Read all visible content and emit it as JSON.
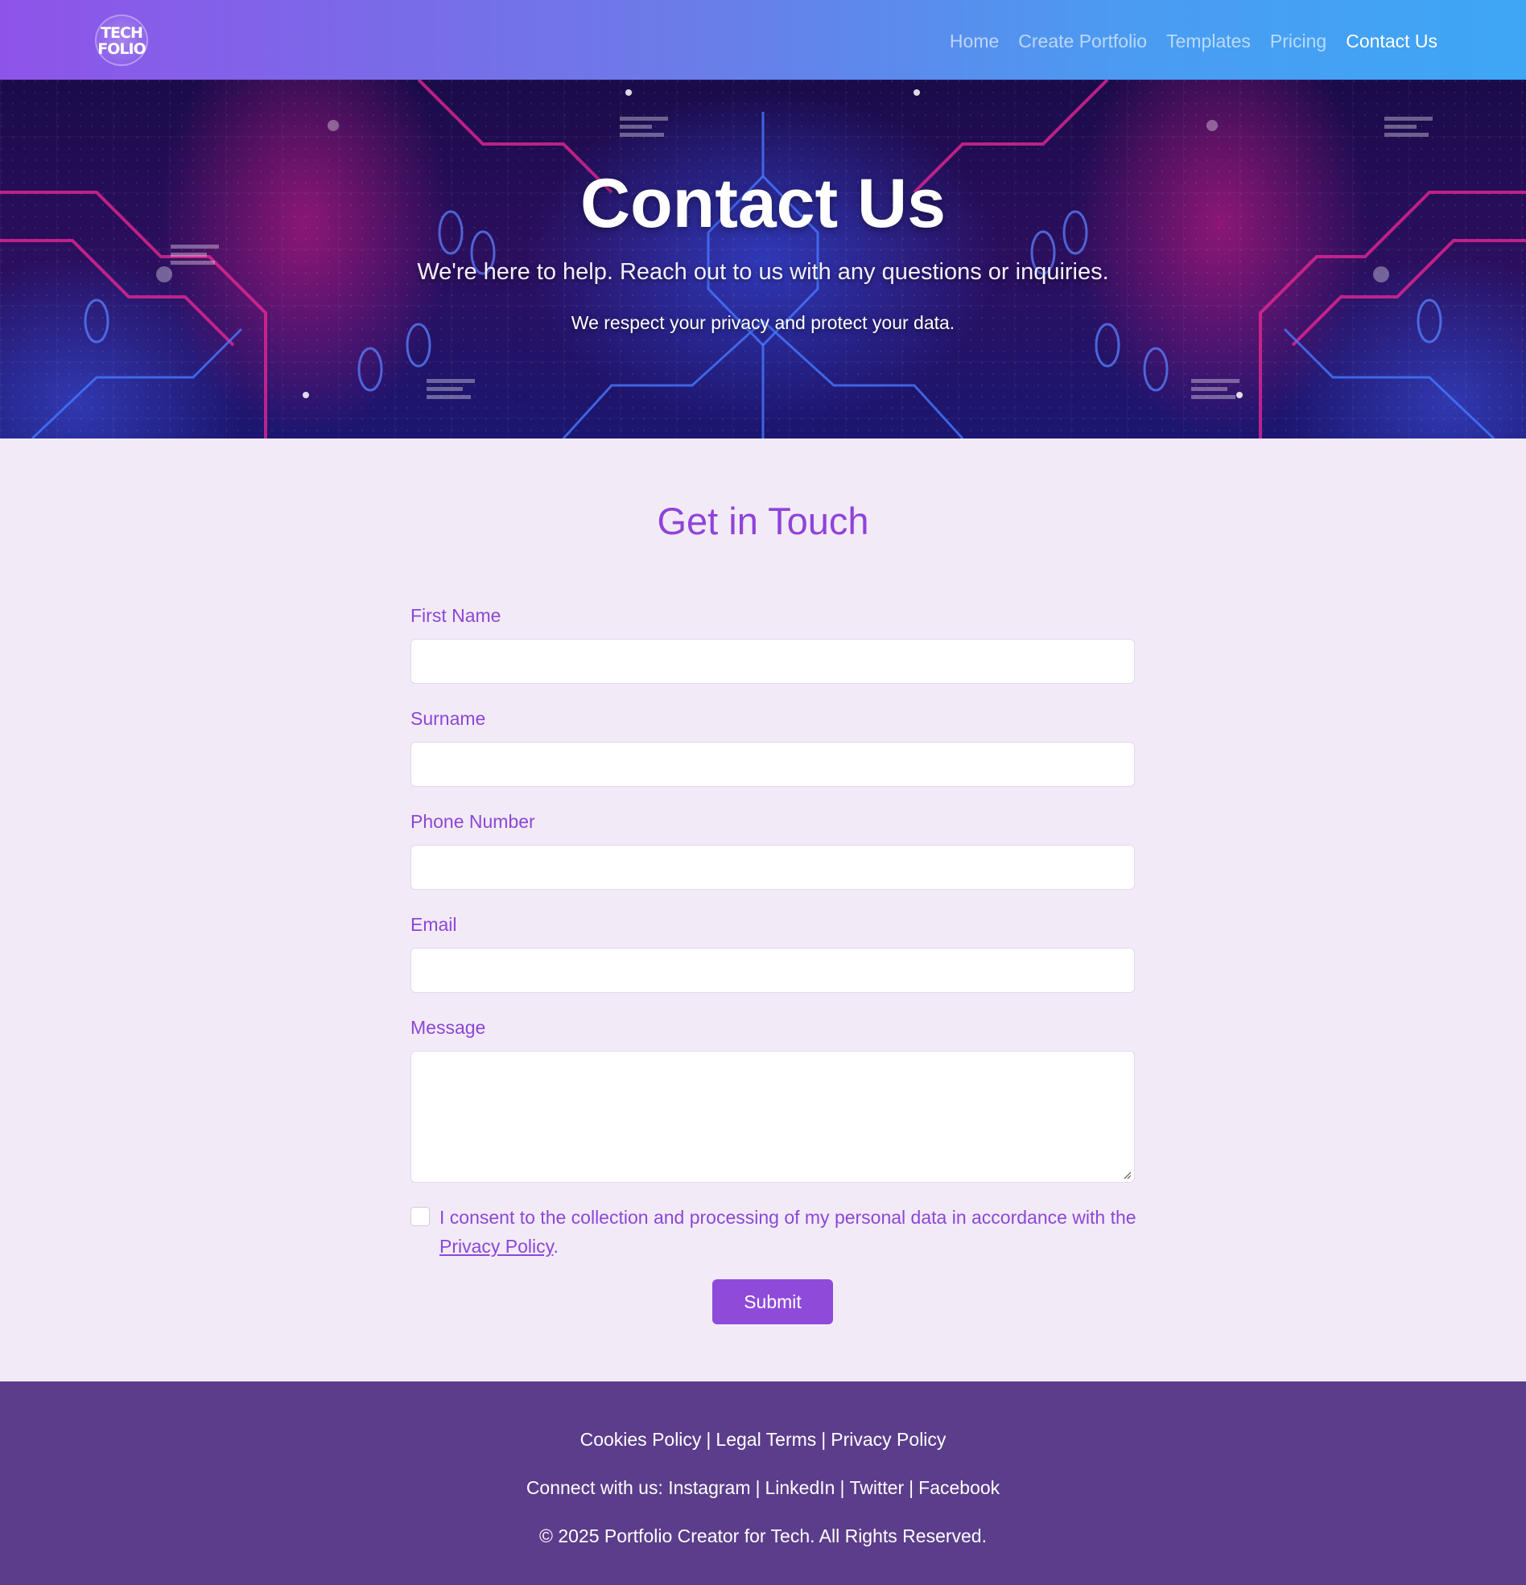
{
  "header": {
    "logo_line1": "TECH",
    "logo_line2": "FOLIO",
    "nav": [
      {
        "label": "Home"
      },
      {
        "label": "Create Portfolio"
      },
      {
        "label": "Templates"
      },
      {
        "label": "Pricing"
      },
      {
        "label": "Contact Us",
        "active": true
      }
    ]
  },
  "hero": {
    "title": "Contact Us",
    "subtitle": "We're here to help. Reach out to us with any questions or inquiries.",
    "note": "We respect your privacy and protect your data."
  },
  "form": {
    "title": "Get in Touch",
    "fields": [
      {
        "label": "First Name",
        "value": ""
      },
      {
        "label": "Surname",
        "value": ""
      },
      {
        "label": "Phone Number",
        "value": ""
      },
      {
        "label": "Email",
        "value": ""
      }
    ],
    "message_label": "Message",
    "message_value": "",
    "consent_text": "I consent to the collection and processing of my personal data in accordance with the ",
    "consent_link": "Privacy Policy",
    "consent_end": ".",
    "consent_checked": false,
    "submit_label": "Submit"
  },
  "footer": {
    "policies": [
      "Cookies Policy",
      "Legal Terms",
      "Privacy Policy"
    ],
    "connect_prefix": "Connect with us:",
    "socials": [
      "Instagram",
      "LinkedIn",
      "Twitter",
      "Facebook"
    ],
    "separator": "|",
    "copyright": "© 2025 Portfolio Creator for Tech. All Rights Reserved."
  },
  "colors": {
    "accent": "#8e4ad9",
    "page_bg": "#f3eaf7",
    "footer_bg": "#5b3d8b",
    "header_gradient_start": "#8e54e9",
    "header_gradient_end": "#3ea6f5"
  }
}
